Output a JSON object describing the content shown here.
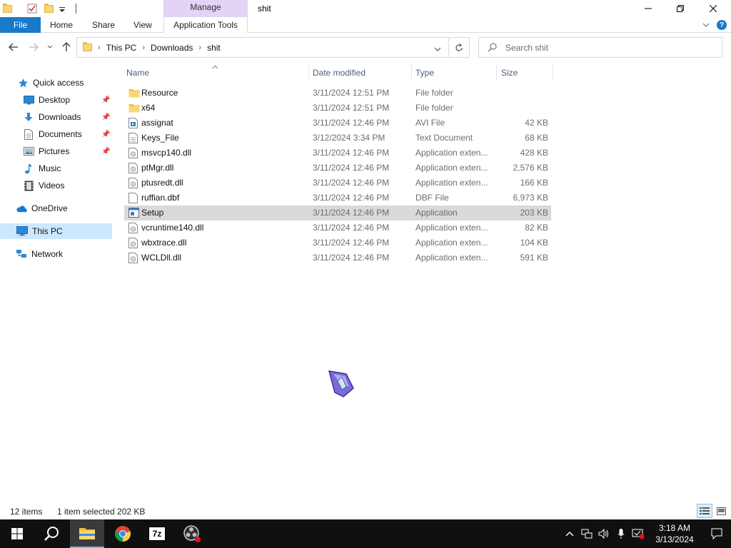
{
  "window": {
    "title": "shit",
    "context_tab": "Manage"
  },
  "ribbon": {
    "tabs": [
      "File",
      "Home",
      "Share",
      "View",
      "Application Tools"
    ]
  },
  "address": {
    "crumbs": [
      "This PC",
      "Downloads",
      "shit"
    ],
    "search_placeholder": "Search shit"
  },
  "navpane": {
    "quick_access": "Quick access",
    "items": [
      {
        "label": "Desktop",
        "pinned": true
      },
      {
        "label": "Downloads",
        "pinned": true
      },
      {
        "label": "Documents",
        "pinned": true
      },
      {
        "label": "Pictures",
        "pinned": true
      },
      {
        "label": "Music",
        "pinned": false
      },
      {
        "label": "Videos",
        "pinned": false
      }
    ],
    "onedrive": "OneDrive",
    "thispc": "This PC",
    "network": "Network"
  },
  "list": {
    "headers": {
      "name": "Name",
      "date": "Date modified",
      "type": "Type",
      "size": "Size"
    },
    "files": [
      {
        "name": "Resource",
        "date": "3/11/2024 12:51 PM",
        "type": "File folder",
        "size": "",
        "icon": "folder-icon"
      },
      {
        "name": "x64",
        "date": "3/11/2024 12:51 PM",
        "type": "File folder",
        "size": "",
        "icon": "folder-icon"
      },
      {
        "name": "assignat",
        "date": "3/11/2024 12:46 PM",
        "type": "AVI File",
        "size": "42 KB",
        "icon": "video-file-icon"
      },
      {
        "name": "Keys_File",
        "date": "3/12/2024 3:34 PM",
        "type": "Text Document",
        "size": "68 KB",
        "icon": "text-file-icon"
      },
      {
        "name": "msvcp140.dll",
        "date": "3/11/2024 12:46 PM",
        "type": "Application exten...",
        "size": "428 KB",
        "icon": "dll-file-icon"
      },
      {
        "name": "ptMgr.dll",
        "date": "3/11/2024 12:46 PM",
        "type": "Application exten...",
        "size": "2,576 KB",
        "icon": "dll-file-icon"
      },
      {
        "name": "ptusredt.dll",
        "date": "3/11/2024 12:46 PM",
        "type": "Application exten...",
        "size": "166 KB",
        "icon": "dll-file-icon"
      },
      {
        "name": "ruffian.dbf",
        "date": "3/11/2024 12:46 PM",
        "type": "DBF File",
        "size": "6,973 KB",
        "icon": "blank-file-icon"
      },
      {
        "name": "Setup",
        "date": "3/11/2024 12:46 PM",
        "type": "Application",
        "size": "203 KB",
        "icon": "app-file-icon",
        "selected": true
      },
      {
        "name": "vcruntime140.dll",
        "date": "3/11/2024 12:46 PM",
        "type": "Application exten...",
        "size": "82 KB",
        "icon": "dll-file-icon"
      },
      {
        "name": "wbxtrace.dll",
        "date": "3/11/2024 12:46 PM",
        "type": "Application exten...",
        "size": "104 KB",
        "icon": "dll-file-icon"
      },
      {
        "name": "WCLDll.dll",
        "date": "3/11/2024 12:46 PM",
        "type": "Application exten...",
        "size": "591 KB",
        "icon": "dll-file-icon"
      }
    ]
  },
  "status": {
    "count": "12 items",
    "selection": "1 item selected  202 KB"
  },
  "taskbar": {
    "time": "3:18 AM",
    "date": "3/13/2024"
  },
  "colors": {
    "file_tab": "#1979ca",
    "context_tab": "#e3d3f5",
    "selection": "#cce8ff",
    "taskbar": "#101010"
  }
}
